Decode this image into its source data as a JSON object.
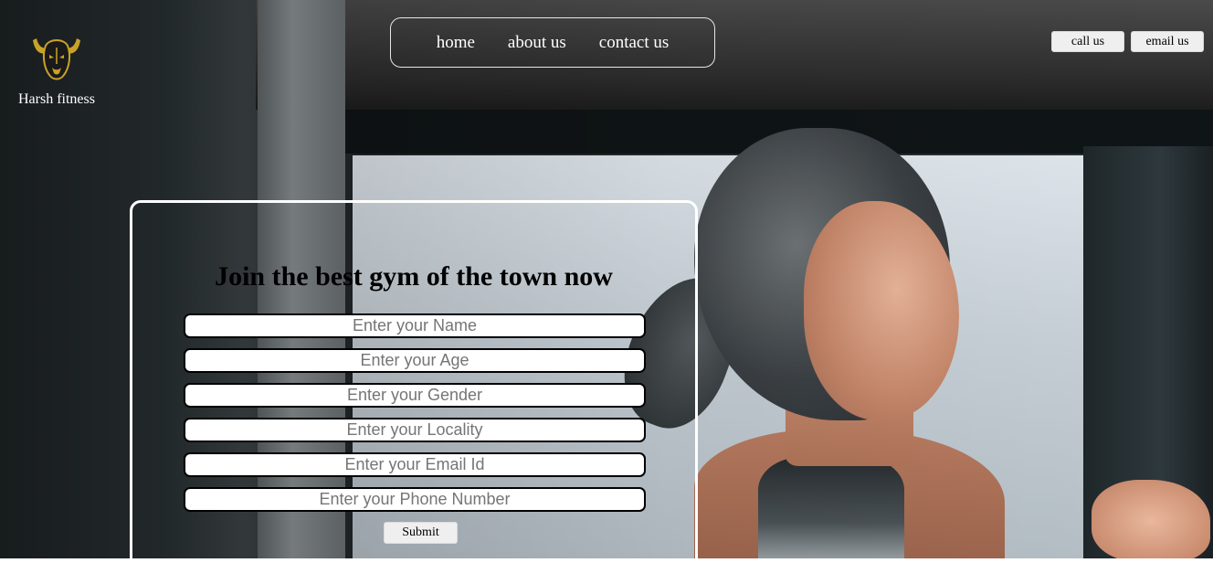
{
  "brand": {
    "name": "Harsh fitness",
    "logo_icon": "bull-head-icon",
    "logo_color": "#c9a227"
  },
  "nav": {
    "items": [
      {
        "label": "home"
      },
      {
        "label": "about us"
      },
      {
        "label": "contact us"
      }
    ]
  },
  "contact": {
    "call_label": "call us",
    "email_label": "email us"
  },
  "form": {
    "heading": "Join the best gym of the town now",
    "fields": [
      {
        "placeholder": "Enter your Name",
        "value": ""
      },
      {
        "placeholder": "Enter your Age",
        "value": ""
      },
      {
        "placeholder": "Enter your Gender",
        "value": ""
      },
      {
        "placeholder": "Enter your Locality",
        "value": ""
      },
      {
        "placeholder": "Enter your Email Id",
        "value": ""
      },
      {
        "placeholder": "Enter your Phone Number",
        "value": ""
      }
    ],
    "submit_label": "Submit"
  },
  "colors": {
    "text_light": "#ffffff",
    "heading": "#000000",
    "border": "#ffffff"
  }
}
